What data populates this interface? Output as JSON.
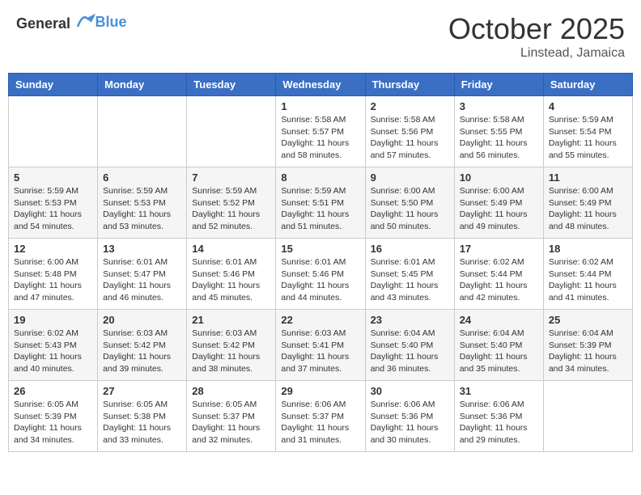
{
  "header": {
    "logo_general": "General",
    "logo_blue": "Blue",
    "month_title": "October 2025",
    "location": "Linstead, Jamaica"
  },
  "days_of_week": [
    "Sunday",
    "Monday",
    "Tuesday",
    "Wednesday",
    "Thursday",
    "Friday",
    "Saturday"
  ],
  "weeks": [
    [
      {
        "day": "",
        "info": ""
      },
      {
        "day": "",
        "info": ""
      },
      {
        "day": "",
        "info": ""
      },
      {
        "day": "1",
        "info": "Sunrise: 5:58 AM\nSunset: 5:57 PM\nDaylight: 11 hours\nand 58 minutes."
      },
      {
        "day": "2",
        "info": "Sunrise: 5:58 AM\nSunset: 5:56 PM\nDaylight: 11 hours\nand 57 minutes."
      },
      {
        "day": "3",
        "info": "Sunrise: 5:58 AM\nSunset: 5:55 PM\nDaylight: 11 hours\nand 56 minutes."
      },
      {
        "day": "4",
        "info": "Sunrise: 5:59 AM\nSunset: 5:54 PM\nDaylight: 11 hours\nand 55 minutes."
      }
    ],
    [
      {
        "day": "5",
        "info": "Sunrise: 5:59 AM\nSunset: 5:53 PM\nDaylight: 11 hours\nand 54 minutes."
      },
      {
        "day": "6",
        "info": "Sunrise: 5:59 AM\nSunset: 5:53 PM\nDaylight: 11 hours\nand 53 minutes."
      },
      {
        "day": "7",
        "info": "Sunrise: 5:59 AM\nSunset: 5:52 PM\nDaylight: 11 hours\nand 52 minutes."
      },
      {
        "day": "8",
        "info": "Sunrise: 5:59 AM\nSunset: 5:51 PM\nDaylight: 11 hours\nand 51 minutes."
      },
      {
        "day": "9",
        "info": "Sunrise: 6:00 AM\nSunset: 5:50 PM\nDaylight: 11 hours\nand 50 minutes."
      },
      {
        "day": "10",
        "info": "Sunrise: 6:00 AM\nSunset: 5:49 PM\nDaylight: 11 hours\nand 49 minutes."
      },
      {
        "day": "11",
        "info": "Sunrise: 6:00 AM\nSunset: 5:49 PM\nDaylight: 11 hours\nand 48 minutes."
      }
    ],
    [
      {
        "day": "12",
        "info": "Sunrise: 6:00 AM\nSunset: 5:48 PM\nDaylight: 11 hours\nand 47 minutes."
      },
      {
        "day": "13",
        "info": "Sunrise: 6:01 AM\nSunset: 5:47 PM\nDaylight: 11 hours\nand 46 minutes."
      },
      {
        "day": "14",
        "info": "Sunrise: 6:01 AM\nSunset: 5:46 PM\nDaylight: 11 hours\nand 45 minutes."
      },
      {
        "day": "15",
        "info": "Sunrise: 6:01 AM\nSunset: 5:46 PM\nDaylight: 11 hours\nand 44 minutes."
      },
      {
        "day": "16",
        "info": "Sunrise: 6:01 AM\nSunset: 5:45 PM\nDaylight: 11 hours\nand 43 minutes."
      },
      {
        "day": "17",
        "info": "Sunrise: 6:02 AM\nSunset: 5:44 PM\nDaylight: 11 hours\nand 42 minutes."
      },
      {
        "day": "18",
        "info": "Sunrise: 6:02 AM\nSunset: 5:44 PM\nDaylight: 11 hours\nand 41 minutes."
      }
    ],
    [
      {
        "day": "19",
        "info": "Sunrise: 6:02 AM\nSunset: 5:43 PM\nDaylight: 11 hours\nand 40 minutes."
      },
      {
        "day": "20",
        "info": "Sunrise: 6:03 AM\nSunset: 5:42 PM\nDaylight: 11 hours\nand 39 minutes."
      },
      {
        "day": "21",
        "info": "Sunrise: 6:03 AM\nSunset: 5:42 PM\nDaylight: 11 hours\nand 38 minutes."
      },
      {
        "day": "22",
        "info": "Sunrise: 6:03 AM\nSunset: 5:41 PM\nDaylight: 11 hours\nand 37 minutes."
      },
      {
        "day": "23",
        "info": "Sunrise: 6:04 AM\nSunset: 5:40 PM\nDaylight: 11 hours\nand 36 minutes."
      },
      {
        "day": "24",
        "info": "Sunrise: 6:04 AM\nSunset: 5:40 PM\nDaylight: 11 hours\nand 35 minutes."
      },
      {
        "day": "25",
        "info": "Sunrise: 6:04 AM\nSunset: 5:39 PM\nDaylight: 11 hours\nand 34 minutes."
      }
    ],
    [
      {
        "day": "26",
        "info": "Sunrise: 6:05 AM\nSunset: 5:39 PM\nDaylight: 11 hours\nand 34 minutes."
      },
      {
        "day": "27",
        "info": "Sunrise: 6:05 AM\nSunset: 5:38 PM\nDaylight: 11 hours\nand 33 minutes."
      },
      {
        "day": "28",
        "info": "Sunrise: 6:05 AM\nSunset: 5:37 PM\nDaylight: 11 hours\nand 32 minutes."
      },
      {
        "day": "29",
        "info": "Sunrise: 6:06 AM\nSunset: 5:37 PM\nDaylight: 11 hours\nand 31 minutes."
      },
      {
        "day": "30",
        "info": "Sunrise: 6:06 AM\nSunset: 5:36 PM\nDaylight: 11 hours\nand 30 minutes."
      },
      {
        "day": "31",
        "info": "Sunrise: 6:06 AM\nSunset: 5:36 PM\nDaylight: 11 hours\nand 29 minutes."
      },
      {
        "day": "",
        "info": ""
      }
    ]
  ]
}
